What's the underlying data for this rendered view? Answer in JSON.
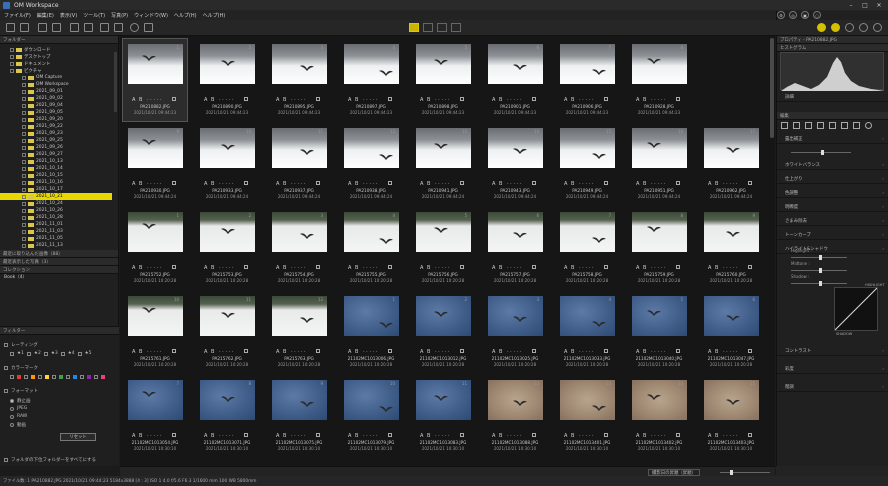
{
  "window": {
    "title": "OM Workspace"
  },
  "menu": [
    "ファイル(F)",
    "編集(E)",
    "表示(V)",
    "ツール(T)",
    "写真(P)",
    "ウィンドウ(W)",
    "ヘルプ(H)",
    "ヘルプ(H)"
  ],
  "left": {
    "tree_header": "フォルダー",
    "tree": [
      {
        "label": "ダウンロード",
        "level": 1
      },
      {
        "label": "デスクトップ",
        "level": 1
      },
      {
        "label": "ドキュメント",
        "level": 1
      },
      {
        "label": "ピクチャ",
        "level": 1
      },
      {
        "label": "OM Capture",
        "level": 2
      },
      {
        "label": "OM Workspace",
        "level": 2
      },
      {
        "label": "2021_09_01",
        "level": 2
      },
      {
        "label": "2021_09_02",
        "level": 2
      },
      {
        "label": "2021_09_04",
        "level": 2
      },
      {
        "label": "2021_09_05",
        "level": 2
      },
      {
        "label": "2021_09_20",
        "level": 2
      },
      {
        "label": "2021_09_22",
        "level": 2
      },
      {
        "label": "2021_09_23",
        "level": 2
      },
      {
        "label": "2021_09_25",
        "level": 2
      },
      {
        "label": "2021_09_26",
        "level": 2
      },
      {
        "label": "2021_09_27",
        "level": 2
      },
      {
        "label": "2021_10_13",
        "level": 2
      },
      {
        "label": "2021_10_14",
        "level": 2
      },
      {
        "label": "2021_10_15",
        "level": 2
      },
      {
        "label": "2021_10_16",
        "level": 2
      },
      {
        "label": "2021_10_17",
        "level": 2
      },
      {
        "label": "2021_10_21",
        "level": 2,
        "selected": true
      },
      {
        "label": "2021_10_24",
        "level": 2
      },
      {
        "label": "2021_10_26",
        "level": 2
      },
      {
        "label": "2021_10_28",
        "level": 2
      },
      {
        "label": "2021_11_01",
        "level": 2
      },
      {
        "label": "2021_11_03",
        "level": 2
      },
      {
        "label": "2021_11_05",
        "level": 2
      },
      {
        "label": "2021_11_13",
        "level": 2
      }
    ],
    "recent_label": "最近に取り込んだ画像（88）",
    "recent2_label": "最近表示した写真（3）",
    "collection_header": "コレクション",
    "collection_item": "Book（4）",
    "filter_header": "フィルター",
    "rating_label": "レーティング",
    "stars": [
      "1",
      "2",
      "3",
      "4",
      "5"
    ],
    "colormark_label": "カラーマーク",
    "format_label": "フォーマット",
    "format_opts": [
      "静止画",
      "JPEG",
      "RAW",
      "動画"
    ],
    "reset_button": "リセット",
    "subfolder_label": "フォルダの下位フォルダーをすべてにする",
    "color_swatches": [
      "#e53935",
      "#ff9800",
      "#fdd835",
      "#43a047",
      "#1e88e5",
      "#8e24aa",
      "#ec407a"
    ]
  },
  "grid": {
    "rows": [
      {
        "kind": "snow",
        "birds": 8,
        "names": [
          "PA210882.JPG",
          "PA210890.JPG",
          "PA210895.JPG",
          "PA210897.JPG",
          "PA210898.JPG",
          "PA210901.JPG",
          "PA210906.JPG",
          "PA210928.JPG"
        ],
        "date": "2021/10/21 09:44:23",
        "stars": "· · · · ·",
        "nums": [
          "1",
          "2",
          "3",
          "4",
          "5",
          "6",
          "7",
          "8"
        ]
      },
      {
        "kind": "snow",
        "names": [
          "PA210930.JPG",
          "PA210933.JPG",
          "PA210937.JPG",
          "PA210938.JPG",
          "PA210941.JPG",
          "PA210943.JPG",
          "PA210949.JPG",
          "PA210951.JPG",
          "PA210962.JPG"
        ],
        "date": "2021/10/21 09:44:24",
        "stars": "· · · · ·",
        "nums": [
          "9",
          "10",
          "11",
          "12",
          "13",
          "14",
          "15",
          "16",
          "17"
        ]
      },
      {
        "kind": "snow2",
        "names": [
          "PA215752.JPG",
          "PA215753.JPG",
          "PA215754.JPG",
          "PA215755.JPG",
          "PA215756.JPG",
          "PA215757.JPG",
          "PA215758.JPG",
          "PA215759.JPG",
          "PA215760.JPG"
        ],
        "date": "2021/10/21 10:20:28",
        "stars": "· · · · ·",
        "nums": [
          "1",
          "2",
          "3",
          "4",
          "5",
          "6",
          "7",
          "8",
          "9"
        ]
      },
      {
        "kind": "mixed",
        "names": [
          "PA215761.JPG",
          "PA215762.JPG",
          "PA215763.JPG",
          "21102MC1013006.JPG",
          "21102MC1013012.JPG",
          "21102MC1013025.JPG",
          "21102MC1013033.JPG",
          "21102MC1013040.JPG",
          "21102MC1013047.JPG"
        ],
        "date": "2021/10/21 10:20:28",
        "stars": "· · · · ·",
        "nums": [
          "10",
          "11",
          "12",
          "1",
          "2",
          "3",
          "4",
          "5",
          "6"
        ]
      },
      {
        "kind": "sky",
        "names": [
          "21102MC1013054.JPG",
          "21102MC1013071.JPG",
          "21102MC1013075.JPG",
          "21102MC1013079.JPG",
          "21102MC1013083.JPG",
          "21102MC1013088.JPG",
          "21102MC1013401.JPG",
          "21102MC1013402.JPG",
          "21102MC1013403.JPG"
        ],
        "date": "2021/10/21 10:30:10",
        "stars": "· · · · ·",
        "nums": [
          "7",
          "8",
          "9",
          "10",
          "11",
          "12",
          "13",
          "14",
          "15"
        ]
      }
    ],
    "ab": "A B"
  },
  "right": {
    "properties_header": "プロパティ - PA210882.JPG",
    "histogram_label": "ヒストグラム",
    "details_label": "詳細",
    "edit_header": "編集",
    "sections": [
      "露出補正",
      "ホワイトバランス",
      "仕上がり",
      "色調整",
      "明瞭度",
      "さまみ除去",
      "トーンカーブ",
      "ハイライト&シャドウ",
      "コントラスト",
      "彩度",
      "階調"
    ],
    "highlight_label": "Highlight :",
    "midtone_label": "Midtone :",
    "shadow_label": "Shadow :",
    "curve_top": "HIGHLIGHT",
    "curve_bottom": "SHADOW",
    "zero": "0"
  },
  "bottom": {
    "sort_label": "撮影日の昇順（昇順）"
  },
  "status": {
    "text": "ファイル数: 1  PA210882.JPG  2021/10/21 09:44:23  5184x3888 [4 : 3]  ISO 1  4.0 f/5.6  F6.3  1/1600 mm  100  WB 5800mm"
  }
}
